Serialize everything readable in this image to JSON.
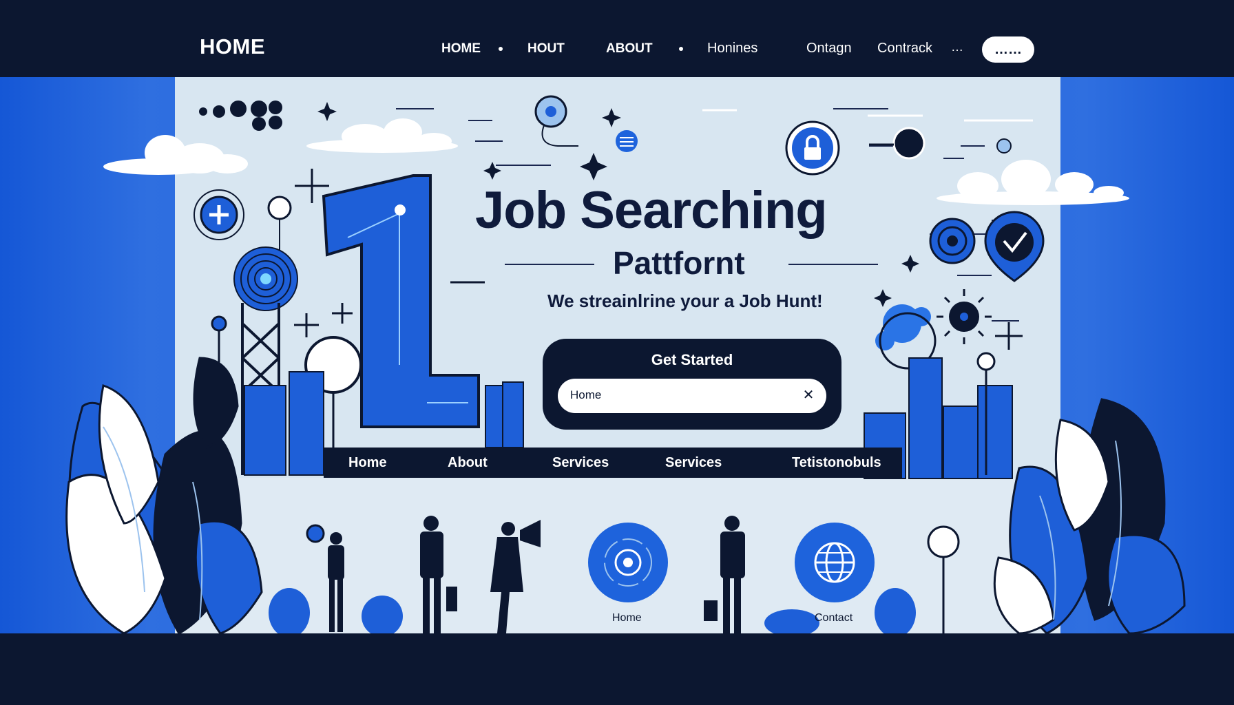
{
  "topnav": {
    "brand": "HOME",
    "items": [
      "HOME",
      "HOUT",
      "ABOUT",
      "Honines",
      "Ontagn",
      "Contrack"
    ],
    "more_glyph": "…",
    "pill_label": "……"
  },
  "hero": {
    "title": "Job Searching",
    "subtitle": "Pattfornt",
    "tagline": "We streainlrine  your a Job Hunt!"
  },
  "search": {
    "button_label": "Get Started",
    "input_value": "Home",
    "clear_icon": "✕"
  },
  "subnav": {
    "items": [
      "Home",
      "About",
      "Services",
      "Services",
      "Tetistonobuls"
    ]
  },
  "circles": {
    "home_label": "Home",
    "contact_label": "Contact"
  },
  "colors": {
    "navy": "#0c1730",
    "accent_blue": "#1e63dc",
    "panel": "#d8e6f1",
    "white": "#ffffff"
  },
  "icons": [
    "plus-icon",
    "lock-icon",
    "target-icon",
    "globe-icon",
    "checkmark-pin-icon",
    "close-icon"
  ]
}
